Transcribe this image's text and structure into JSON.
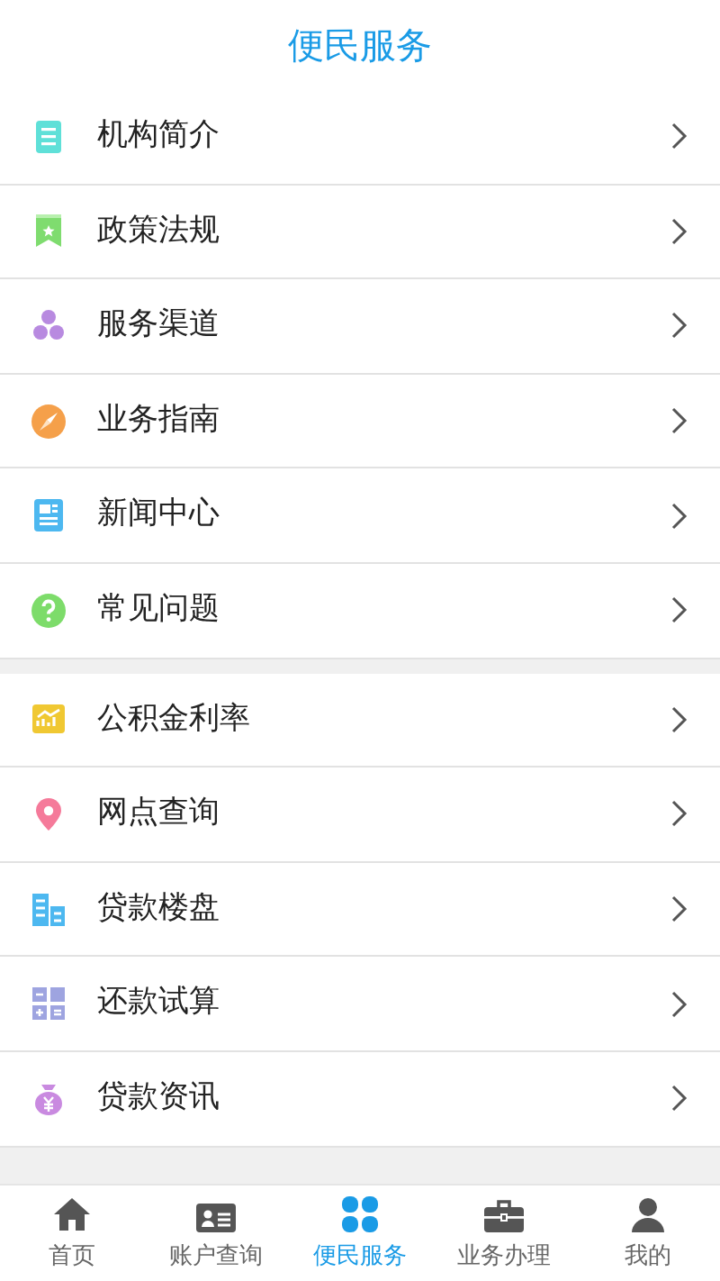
{
  "header": {
    "title": "便民服务"
  },
  "groups": [
    {
      "items": [
        {
          "label": "机构简介"
        },
        {
          "label": "政策法规"
        },
        {
          "label": "服务渠道"
        },
        {
          "label": "业务指南"
        },
        {
          "label": "新闻中心"
        },
        {
          "label": "常见问题"
        }
      ]
    },
    {
      "items": [
        {
          "label": "公积金利率"
        },
        {
          "label": "网点查询"
        },
        {
          "label": "贷款楼盘"
        },
        {
          "label": "还款试算"
        },
        {
          "label": "贷款资讯"
        }
      ]
    }
  ],
  "tab_bar": [
    {
      "label": "首页",
      "selected": false
    },
    {
      "label": "账户查询",
      "selected": false
    },
    {
      "label": "便民服务",
      "selected": true
    },
    {
      "label": "业务办理",
      "selected": false
    },
    {
      "label": "我的",
      "selected": false
    }
  ]
}
